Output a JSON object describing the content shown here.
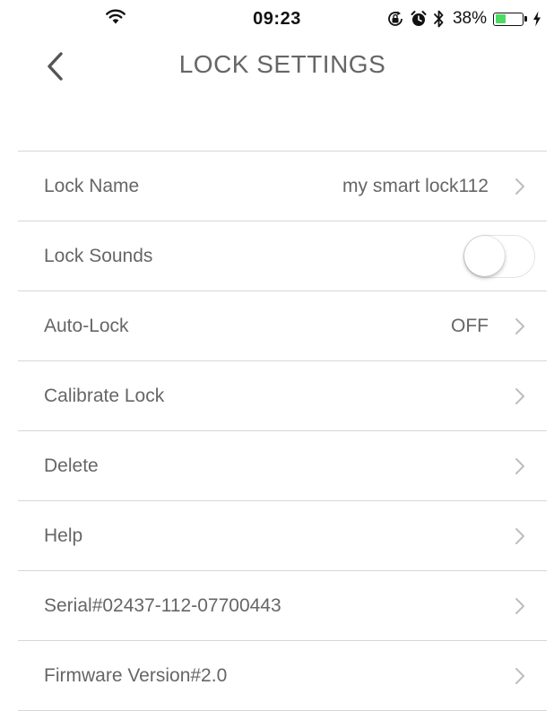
{
  "status_bar": {
    "time": "09:23",
    "battery_percent": "38%",
    "battery_level": 0.38,
    "battery_color": "#4cd964",
    "icons": [
      "wifi-icon",
      "rotation-lock-icon",
      "alarm-icon",
      "bluetooth-icon",
      "battery-icon",
      "charging-icon"
    ]
  },
  "header": {
    "back_icon": "chevron-left-icon",
    "title": "LOCK SETTINGS"
  },
  "settings": {
    "rows": [
      {
        "label": "Lock Name",
        "value": "my smart lock112",
        "chevron": true
      },
      {
        "label": "Lock Sounds",
        "toggle": false
      },
      {
        "label": "Auto-Lock",
        "value": "OFF",
        "chevron": true
      },
      {
        "label": "Calibrate Lock",
        "value": "",
        "chevron": true
      },
      {
        "label": "Delete",
        "value": "",
        "chevron": true
      },
      {
        "label": "Help",
        "value": "",
        "chevron": true
      },
      {
        "label": "Serial#02437-112-07700443",
        "value": "",
        "chevron": true
      },
      {
        "label": "Firmware Version#2.0",
        "value": "",
        "chevron": true
      }
    ]
  }
}
